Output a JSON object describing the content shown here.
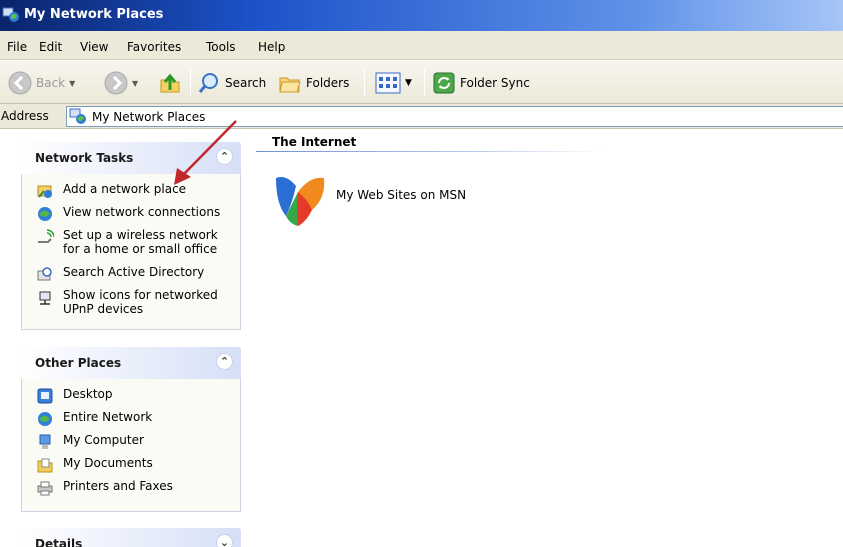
{
  "window": {
    "title": "My Network Places"
  },
  "menu": [
    "File",
    "Edit",
    "View",
    "Favorites",
    "Tools",
    "Help"
  ],
  "toolbar": {
    "back_label": "Back",
    "search_label": "Search",
    "folders_label": "Folders",
    "foldersync_label": "Folder Sync"
  },
  "address": {
    "label": "Address",
    "value": "My Network Places"
  },
  "panels": {
    "network_tasks": {
      "title": "Network Tasks",
      "items": [
        {
          "label": "Add a network place",
          "icon": "add-network-place-icon"
        },
        {
          "label": "View network connections",
          "icon": "network-connections-icon"
        },
        {
          "label": "Set up a wireless network\nfor a home or small office",
          "icon": "wireless-network-icon"
        },
        {
          "label": "Search Active Directory",
          "icon": "search-directory-icon"
        },
        {
          "label": "Show icons for networked\nUPnP devices",
          "icon": "upnp-device-icon"
        }
      ]
    },
    "other_places": {
      "title": "Other Places",
      "items": [
        {
          "label": "Desktop",
          "icon": "desktop-icon"
        },
        {
          "label": "Entire Network",
          "icon": "globe-icon"
        },
        {
          "label": "My Computer",
          "icon": "computer-icon"
        },
        {
          "label": "My Documents",
          "icon": "documents-folder-icon"
        },
        {
          "label": "Printers and Faxes",
          "icon": "printer-icon"
        }
      ]
    },
    "details": {
      "title": "Details"
    }
  },
  "content": {
    "group_title": "The Internet",
    "items": [
      {
        "label": "My Web Sites on MSN",
        "icon": "msn-butterfly-icon"
      }
    ]
  },
  "colors": {
    "titlebar": "#0a246a",
    "chrome": "#ece9d8",
    "panel_header": "#d6dff7",
    "annotation_arrow": "#c0282e"
  }
}
